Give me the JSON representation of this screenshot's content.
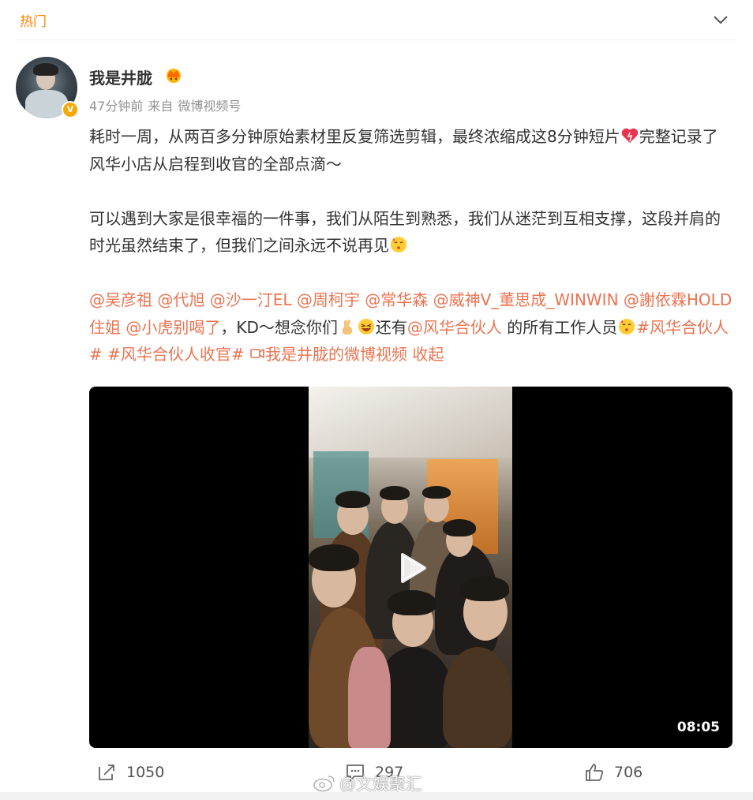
{
  "header": {
    "hot_label": "热门"
  },
  "post": {
    "username": "我是井胧",
    "verified_badge": "V",
    "meta": {
      "time": "47分钟前",
      "source_prefix": "来自",
      "source": "微博视频号"
    },
    "para1": {
      "text1": "耗时一周，从两百多分钟原始素材里反复筛选剪辑，最终浓缩成这8分钟短片",
      "text2": "完整记录了风华小店从启程到收官的全部点滴～"
    },
    "para2": {
      "text1": "可以遇到大家是很幸福的一件事，我们从陌生到熟悉，我们从迷茫到互相支撑，这段并肩的时光虽然结束了，但我们之间永远不说再见"
    },
    "para3": {
      "mentions": [
        "@吴彦祖",
        "@代旭",
        "@沙一汀EL",
        "@周柯宇",
        "@常华森",
        "@威神V_董思成_WINWIN",
        "@謝依霖HOLD住姐",
        "@小虎别喝了"
      ],
      "text_kd": "，KD～想念你们",
      "text_also": "还有",
      "mention_partner": "@风华合伙人",
      "text_staff": " 的所有工作人员",
      "hashtag1": "#风华合伙人#",
      "hashtag2": "#风华合伙人收官#",
      "video_link": "我是井胧的微博视频",
      "collapse_link": "收起"
    },
    "video": {
      "duration": "08:05"
    }
  },
  "actions": {
    "repost_count": "1050",
    "comment_count": "297",
    "like_count": "706"
  },
  "watermark": "@文娱聚汇",
  "colors": {
    "accent": "#ff8200",
    "link": "#eb7350",
    "meta": "#939393"
  },
  "icons": [
    "chevron-down-icon",
    "crown-icon",
    "verified-icon",
    "heart-icon",
    "kiss-emoji-icon",
    "fingers-crossed-emoji-icon",
    "laughing-emoji-icon",
    "video-link-icon",
    "play-icon",
    "repost-icon",
    "comment-icon",
    "like-icon",
    "weibo-logo-icon"
  ]
}
